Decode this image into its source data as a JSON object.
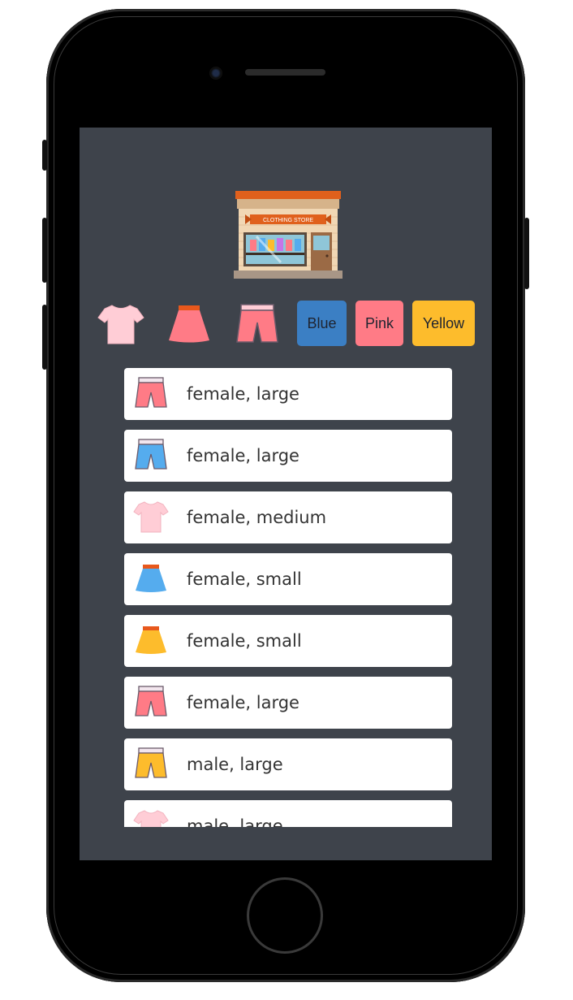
{
  "filters": {
    "types": [
      {
        "name": "shirt",
        "icon": "tshirt-icon",
        "color": "#ffcdd6"
      },
      {
        "name": "skirt",
        "icon": "skirt-icon",
        "color": "#ff7f8a"
      },
      {
        "name": "shorts",
        "icon": "shorts-icon",
        "color": "#ff7f8a"
      }
    ],
    "colors": [
      {
        "label": "Blue",
        "bg": "#3b7fc4"
      },
      {
        "label": "Pink",
        "bg": "#ff7b86"
      },
      {
        "label": "Yellow",
        "bg": "#fdbc2c"
      }
    ]
  },
  "products": [
    {
      "icon": "shorts-icon",
      "color": "#ff7b86",
      "label": "female, large"
    },
    {
      "icon": "shorts-icon",
      "color": "#55acee",
      "label": "female, large"
    },
    {
      "icon": "tshirt-icon",
      "color": "#ffcdd6",
      "label": "female, medium"
    },
    {
      "icon": "skirt-icon",
      "color": "#55acee",
      "label": "female, small"
    },
    {
      "icon": "skirt-icon",
      "color": "#fdbc2c",
      "label": "female, small"
    },
    {
      "icon": "shorts-icon",
      "color": "#ff7b86",
      "label": "female, large"
    },
    {
      "icon": "shorts-icon",
      "color": "#fdbc2c",
      "label": "male, large"
    },
    {
      "icon": "tshirt-icon",
      "color": "#ffcdd6",
      "label": "male, large"
    }
  ]
}
